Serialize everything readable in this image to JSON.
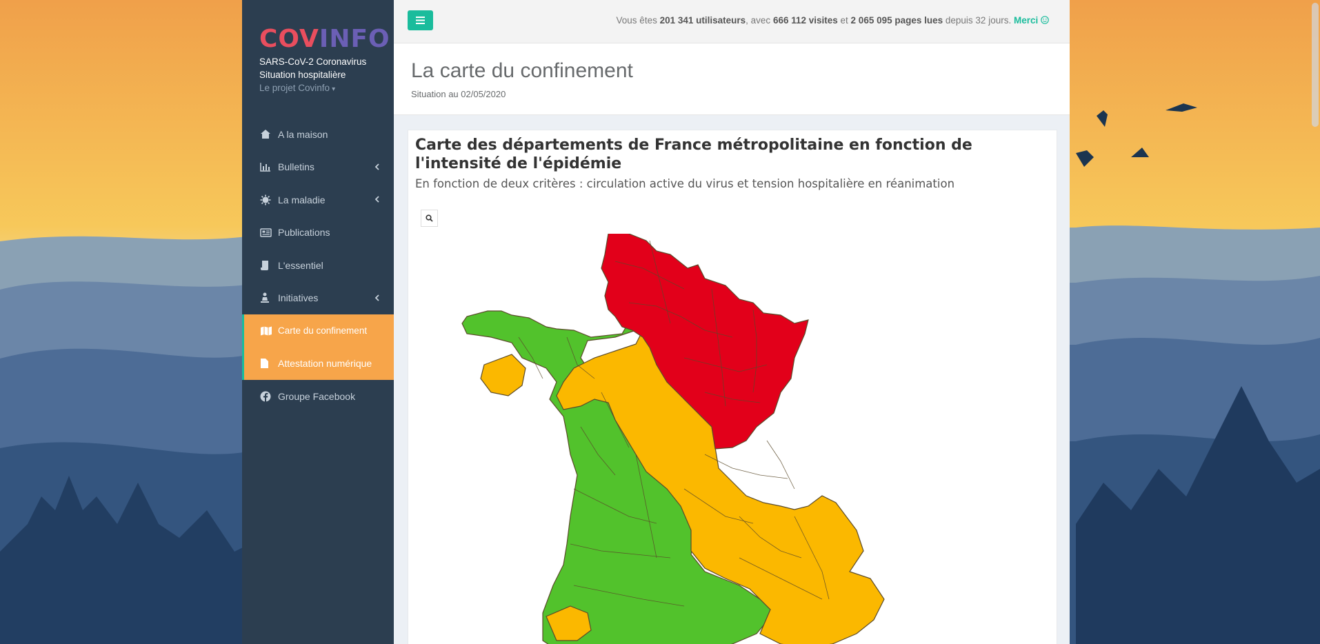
{
  "theme": {
    "accent": "#1abc9c",
    "sidebar_bg": "#2c3e50",
    "active_bg": "#f7a54a"
  },
  "brand": {
    "logo_part1": "COV",
    "logo_part2": "INFO",
    "subtitle_line1": "SARS-CoV-2 Coronavirus",
    "subtitle_line2": "Situation hospitalière",
    "project_label": "Le projet Covinfo"
  },
  "menu": {
    "items": [
      {
        "label": "A la maison",
        "icon": "home-icon"
      },
      {
        "label": "Bulletins",
        "icon": "bar-chart-icon"
      },
      {
        "label": "La maladie",
        "icon": "virus-icon"
      },
      {
        "label": "Publications",
        "icon": "newspaper-icon"
      },
      {
        "label": "L'essentiel",
        "icon": "scroll-icon"
      },
      {
        "label": "Initiatives",
        "icon": "user-hands-icon"
      },
      {
        "label": "Carte du confinement",
        "icon": "map-icon"
      },
      {
        "label": "Attestation numérique",
        "icon": "file-icon"
      },
      {
        "label": "Groupe Facebook",
        "icon": "facebook-icon"
      }
    ]
  },
  "topbar": {
    "stats_prefix": "Vous êtes ",
    "users": "201 341 utilisateurs",
    "text2": ", avec ",
    "visits": "666 112 visites",
    "text3": " et ",
    "pages": "2 065 095 pages lues",
    "text4": " depuis 32 jours. ",
    "merci": "Merci"
  },
  "header": {
    "title": "La carte du confinement",
    "subtitle": "Situation au 02/05/2020"
  },
  "card": {
    "title": "Carte des départements de France métropolitaine en fonction de l'intensité de l'épidémie",
    "subtitle": "En fonction de deux critères : circulation active du virus et tension hospitalière en réanimation"
  },
  "map": {
    "colors": {
      "red": "#e2001a",
      "orange": "#fbb800",
      "green": "#52c22c",
      "border": "#5a4a2a"
    },
    "zones": [
      "red",
      "orange",
      "green"
    ]
  }
}
